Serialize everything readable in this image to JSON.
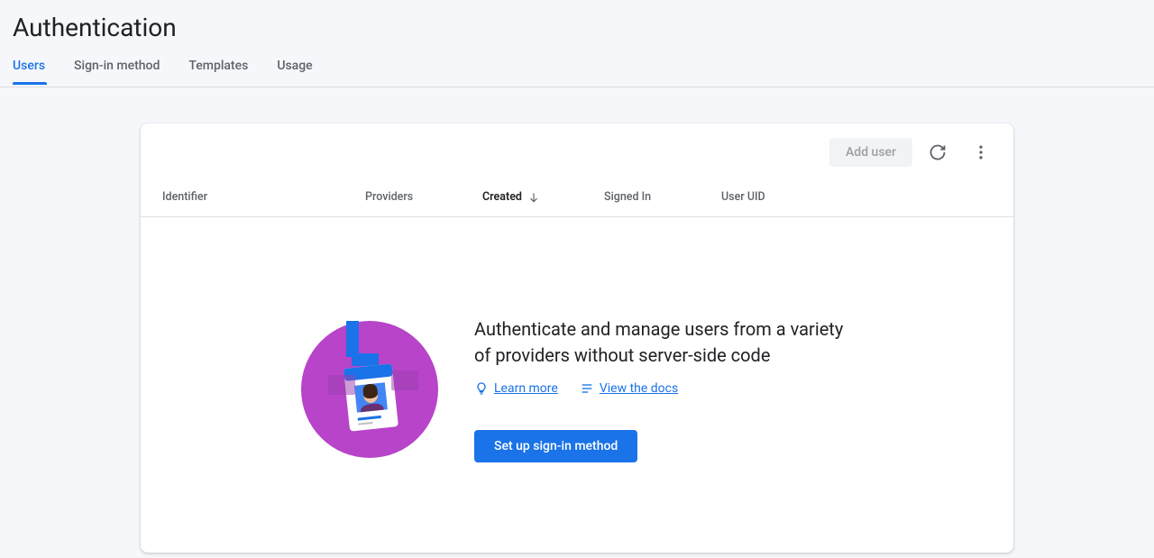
{
  "header": {
    "title": "Authentication"
  },
  "tabs": [
    {
      "label": "Users",
      "active": true
    },
    {
      "label": "Sign-in method",
      "active": false
    },
    {
      "label": "Templates",
      "active": false
    },
    {
      "label": "Usage",
      "active": false
    }
  ],
  "toolbar": {
    "add_user_label": "Add user",
    "refresh_icon": "refresh-icon",
    "more_icon": "more-vert-icon"
  },
  "table": {
    "columns": {
      "identifier": "Identifier",
      "providers": "Providers",
      "created": "Created",
      "signed_in": "Signed In",
      "user_uid": "User UID"
    },
    "sort_column": "created",
    "sort_direction": "desc"
  },
  "empty_state": {
    "heading": "Authenticate and manage users from a variety of providers without server-side code",
    "learn_more_label": "Learn more",
    "view_docs_label": "View the docs",
    "primary_action_label": "Set up sign-in method"
  }
}
